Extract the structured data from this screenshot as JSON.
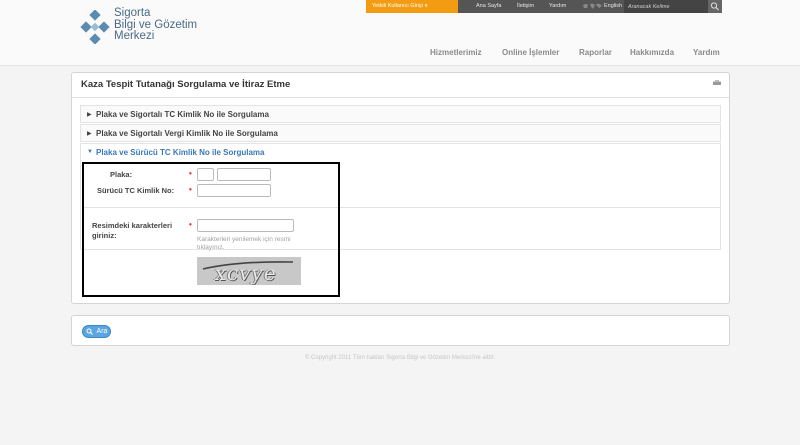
{
  "brand": {
    "line1": "Sigorta",
    "line2": "Bilgi ve Gözetim",
    "line3": "Merkezi",
    "color": "#4a6a84",
    "icon": "diamond-cluster-logo"
  },
  "topbar": {
    "user_label": "Yetkili Kullanıcı Girişi",
    "links": [
      "Ana Sayfa",
      "İletişim",
      "Yardım",
      "English"
    ],
    "search_placeholder": "Aranacak Kelime",
    "accent": "#f39c12"
  },
  "nav": {
    "items": [
      "Hizmetlerimiz",
      "Online İşlemler",
      "Raporlar",
      "Hakkımızda",
      "Yardım"
    ]
  },
  "panel": {
    "title": "Kaza Tespit Tutanağı Sorgulama ve İtiraz Etme",
    "sections": [
      "Plaka ve Sigortalı TC Kimlik No ile Sorgulama",
      "Plaka ve Sigortalı Vergi Kimlik No ile Sorgulama",
      "Plaka ve Sürücü TC Kimlik No ile Sorgulama"
    ],
    "form": {
      "plate_label": "Plaka:",
      "driver_id_label": "Sürücü TC Kimlik No:",
      "captcha_label": "Resimdeki karakterleri giriniz:",
      "captcha_hint": "Karakterleri yenilemek için resmi tıklayınız.",
      "captcha_text": "xcvye",
      "required_mark": "•"
    }
  },
  "actions": {
    "search_label": "Ara"
  },
  "footer": {
    "text": "© Copyright 2011 Tüm hakları Sigorta Bilgi ve Gözetim Merkezi'ne aittir."
  }
}
